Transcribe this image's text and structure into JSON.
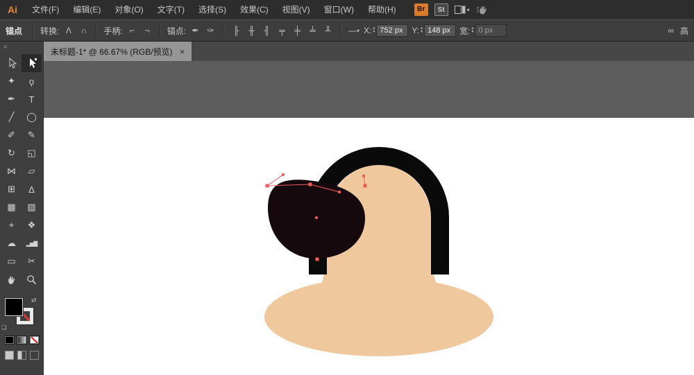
{
  "menu": {
    "logo": "Ai",
    "items": [
      {
        "label": "文件(F)"
      },
      {
        "label": "编辑(E)"
      },
      {
        "label": "对象(O)"
      },
      {
        "label": "文字(T)"
      },
      {
        "label": "选择(S)"
      },
      {
        "label": "效果(C)"
      },
      {
        "label": "视图(V)"
      },
      {
        "label": "窗口(W)"
      },
      {
        "label": "帮助(H)"
      }
    ],
    "bridge_badge": "Br",
    "stock_badge": "St"
  },
  "control_bar": {
    "context_label": "锚点",
    "convert_label": "转换:",
    "handles_label": "手柄:",
    "anchors_label": "锚点:",
    "x_label": "X:",
    "x_value": "752 px",
    "y_label": "Y:",
    "y_value": "148 px",
    "w_label": "宽:",
    "w_value": "0 px",
    "h_label": "高",
    "icons": {
      "convert_corner": "Λ",
      "convert_smooth": "∩",
      "handle_show": "⌐",
      "handle_hide": "¬",
      "anchor_remove": "✒",
      "anchor_add": "✑",
      "align_left": "╟",
      "align_center": "╫",
      "align_right": "╢",
      "align_top": "╤",
      "align_middle": "╪",
      "align_bottom": "╧",
      "distribute": "╨",
      "dash": "—",
      "caret": "▾",
      "link": "∞",
      "up": "▴",
      "down": "▾"
    }
  },
  "document_tab": {
    "title": "未标题-1* @ 66.67% (RGB/预览)",
    "close_glyph": "×"
  },
  "tools_panel": {
    "collapse_glyph": "«",
    "tools": [
      {
        "name": "selection-tool",
        "glyph": ""
      },
      {
        "name": "direct-selection-tool",
        "glyph": "",
        "active": true
      },
      {
        "name": "magic-wand-tool",
        "glyph": "✦"
      },
      {
        "name": "lasso-tool",
        "glyph": "ϙ"
      },
      {
        "name": "pen-tool",
        "glyph": "✒"
      },
      {
        "name": "type-tool",
        "glyph": "T"
      },
      {
        "name": "line-segment-tool",
        "glyph": "╱"
      },
      {
        "name": "ellipse-tool",
        "glyph": "◯"
      },
      {
        "name": "paintbrush-tool",
        "glyph": "✐"
      },
      {
        "name": "pencil-tool",
        "glyph": "✎"
      },
      {
        "name": "rotate-tool",
        "glyph": "↻"
      },
      {
        "name": "scale-tool",
        "glyph": "◱"
      },
      {
        "name": "width-tool",
        "glyph": "⋈"
      },
      {
        "name": "free-transform-tool",
        "glyph": "▱"
      },
      {
        "name": "shape-builder-tool",
        "glyph": "⊞"
      },
      {
        "name": "perspective-grid-tool",
        "glyph": "∆"
      },
      {
        "name": "mesh-tool",
        "glyph": "▦"
      },
      {
        "name": "gradient-tool",
        "glyph": "▨"
      },
      {
        "name": "eyedropper-tool",
        "glyph": "⌖"
      },
      {
        "name": "blend-tool",
        "glyph": "❖"
      },
      {
        "name": "symbol-sprayer-tool",
        "glyph": "☁"
      },
      {
        "name": "column-graph-tool",
        "glyph": "▂▅▇"
      },
      {
        "name": "artboard-tool",
        "glyph": "▭"
      },
      {
        "name": "slice-tool",
        "glyph": "✂"
      },
      {
        "name": "hand-tool",
        "glyph": ""
      },
      {
        "name": "zoom-tool",
        "glyph": ""
      }
    ]
  },
  "artwork": {
    "skin_color": "#f0c89e",
    "hair_color": "#0a0a0a",
    "selected_blob_color": "#16090e",
    "selection_color": "#f05b5b",
    "artboard_color": "#ffffff",
    "pasteboard_color": "#5d5d5d"
  }
}
